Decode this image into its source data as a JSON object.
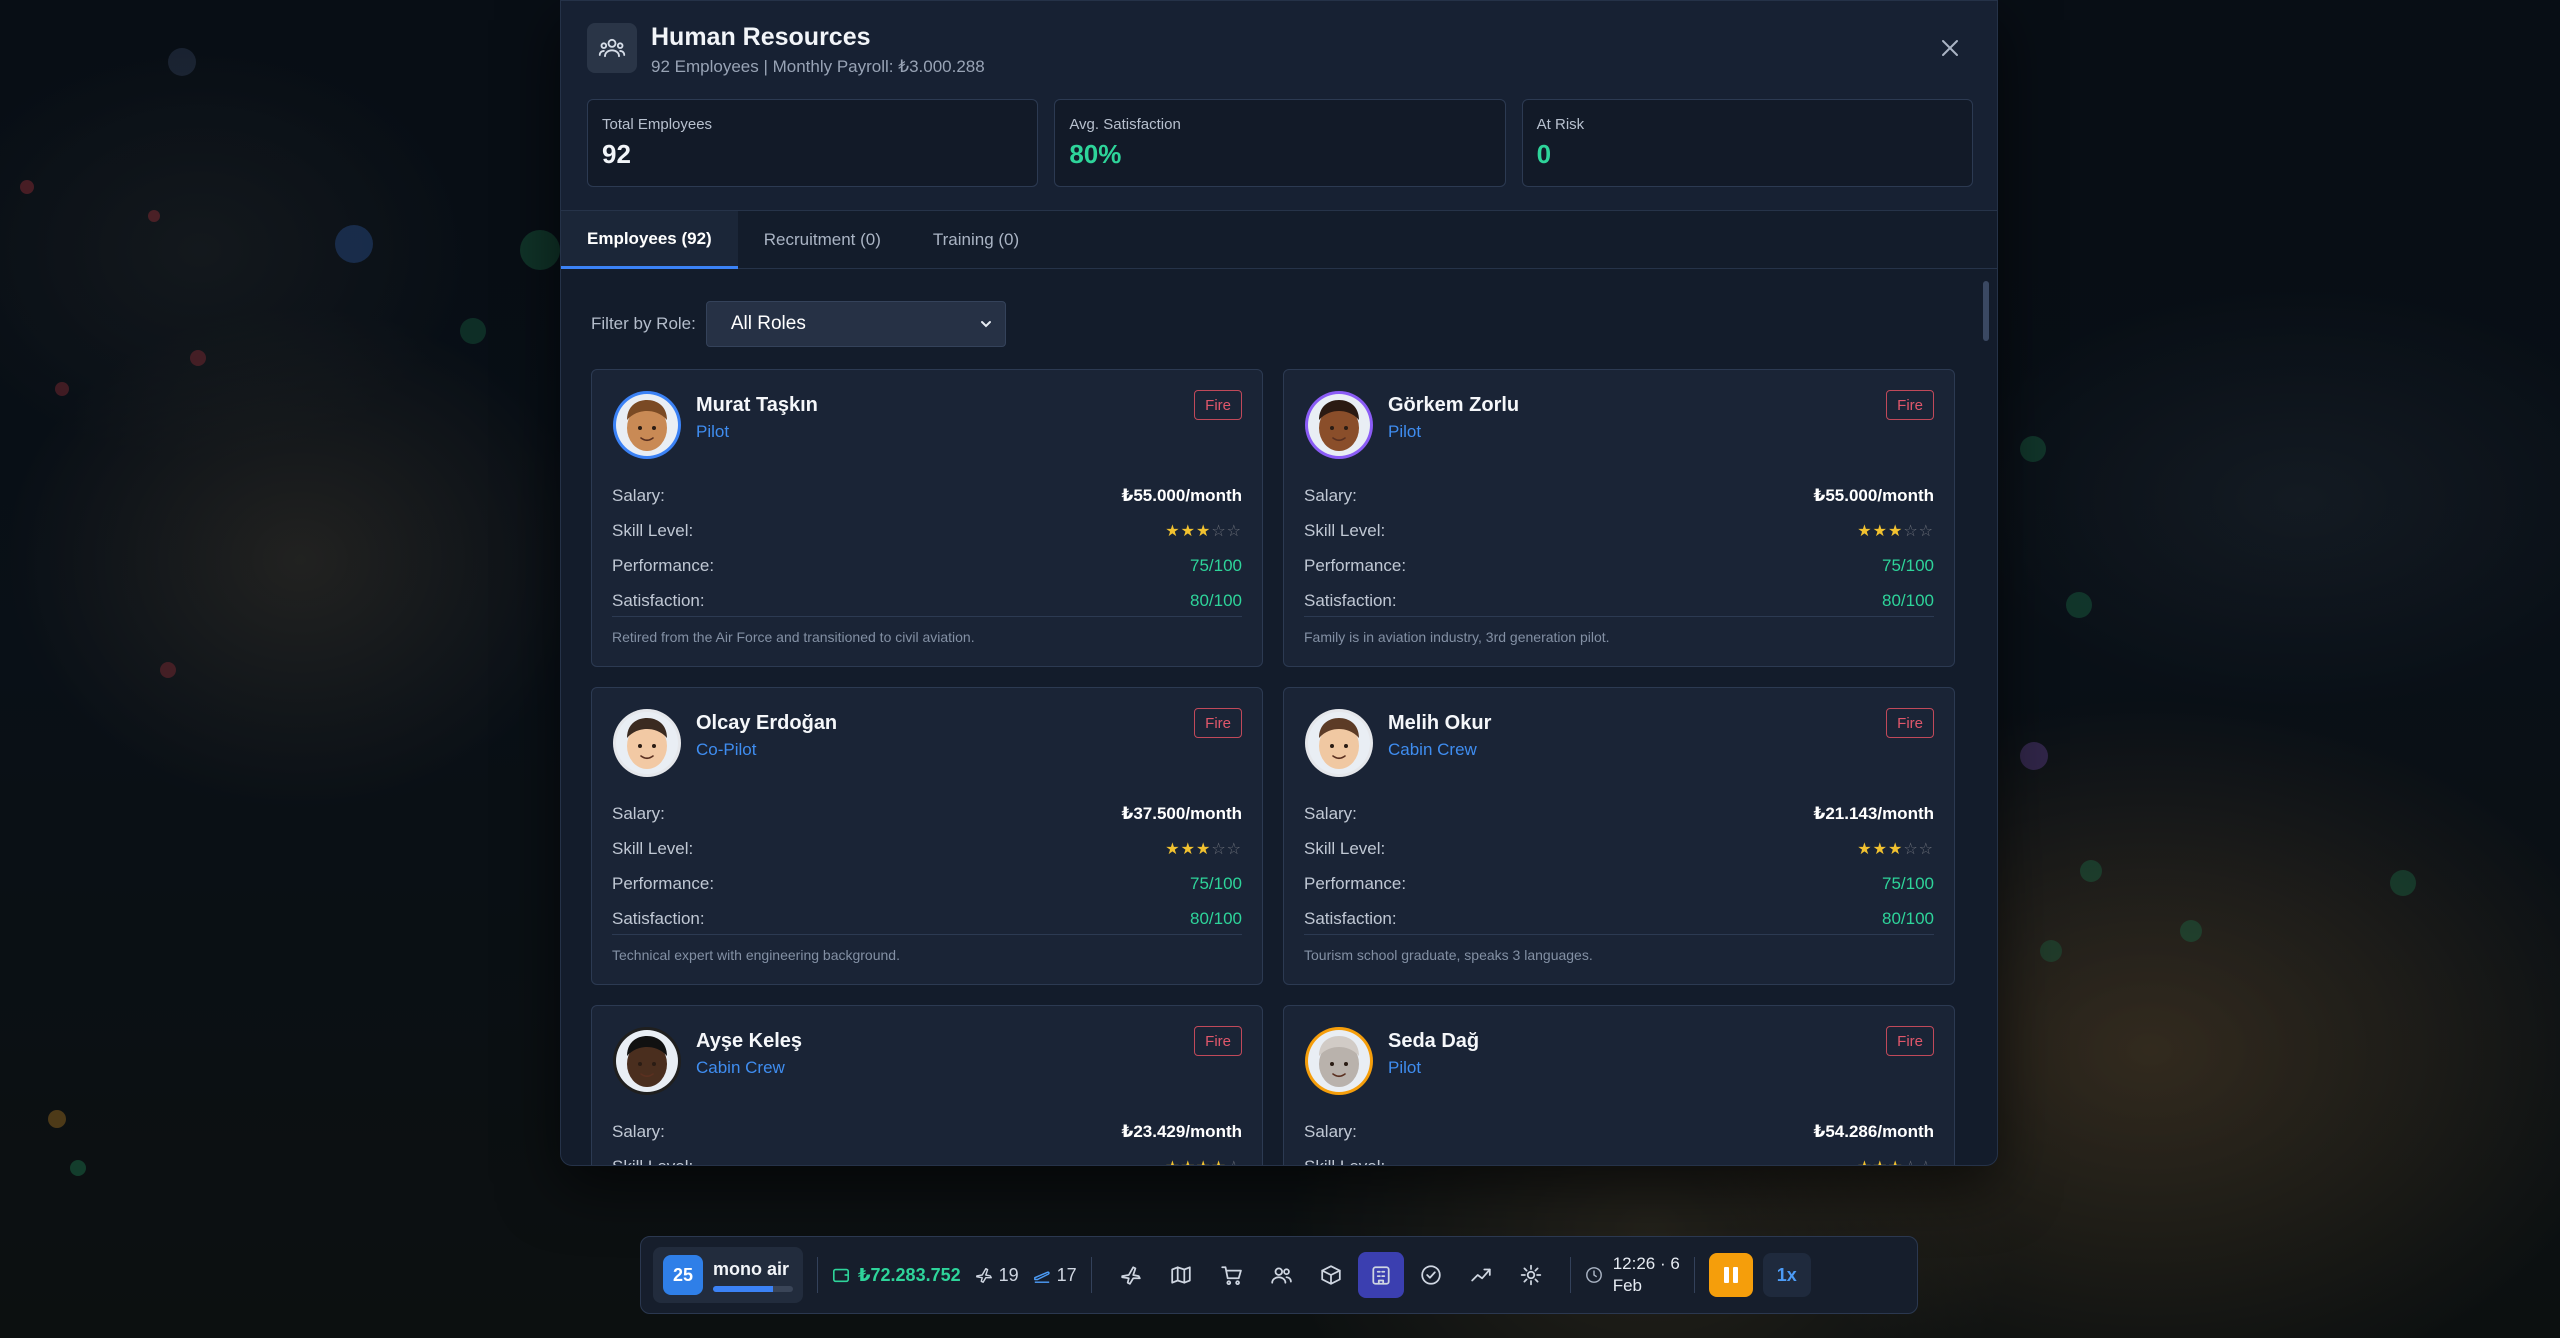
{
  "modal": {
    "title": "Human Resources",
    "subtitle": "92 Employees | Monthly Payroll: ₺3.000.288",
    "close_icon": "close-icon",
    "header_icon": "people-icon"
  },
  "stats": [
    {
      "label": "Total Employees",
      "value": "92"
    },
    {
      "label": "Avg. Satisfaction",
      "value": "80%"
    },
    {
      "label": "At Risk",
      "value": "0"
    }
  ],
  "tabs": [
    {
      "label": "Employees (92)",
      "active": true
    },
    {
      "label": "Recruitment (0)",
      "active": false
    },
    {
      "label": "Training (0)",
      "active": false
    }
  ],
  "filter": {
    "label": "Filter by Role:",
    "selected": "All Roles"
  },
  "field_labels": {
    "salary": "Salary:",
    "skill": "Skill Level:",
    "performance": "Performance:",
    "satisfaction": "Satisfaction:",
    "fire": "Fire"
  },
  "employees": [
    {
      "name": "Murat Taşkın",
      "role": "Pilot",
      "salary": "₺55.000/month",
      "skill_stars": 3,
      "performance": "75/100",
      "satisfaction": "80/100",
      "bio": "Retired from the Air Force and transitioned to civil aviation.",
      "avatar_ring": "#3b82f6",
      "skin": "#c98a55",
      "hair": "#7a4a24"
    },
    {
      "name": "Görkem Zorlu",
      "role": "Pilot",
      "salary": "₺55.000/month",
      "skill_stars": 3,
      "performance": "75/100",
      "satisfaction": "80/100",
      "bio": "Family is in aviation industry, 3rd generation pilot.",
      "avatar_ring": "#8b5cf6",
      "skin": "#8a4e2a",
      "hair": "#2b1a12"
    },
    {
      "name": "Olcay Erdoğan",
      "role": "Co-Pilot",
      "salary": "₺37.500/month",
      "skill_stars": 3,
      "performance": "75/100",
      "satisfaction": "80/100",
      "bio": "Technical expert with engineering background.",
      "avatar_ring": "#e5e7eb",
      "skin": "#f2c9a4",
      "hair": "#3a2a20"
    },
    {
      "name": "Melih Okur",
      "role": "Cabin Crew",
      "salary": "₺21.143/month",
      "skill_stars": 3,
      "performance": "75/100",
      "satisfaction": "80/100",
      "bio": "Tourism school graduate, speaks 3 languages.",
      "avatar_ring": "#e5e7eb",
      "skin": "#f0c8a2",
      "hair": "#5c3b26"
    },
    {
      "name": "Ayşe Keleş",
      "role": "Cabin Crew",
      "salary": "₺23.429/month",
      "skill_stars": 4,
      "performance": "",
      "satisfaction": "",
      "bio": "",
      "avatar_ring": "#1f1f1f",
      "skin": "#4a2e1e",
      "hair": "#111111"
    },
    {
      "name": "Seda Dağ",
      "role": "Pilot",
      "salary": "₺54.286/month",
      "skill_stars": 3,
      "performance": "",
      "satisfaction": "",
      "bio": "",
      "avatar_ring": "#f59e0b",
      "skin": "#b9b2ac",
      "hair": "#d1cbc6"
    }
  ],
  "bottom_bar": {
    "level": "25",
    "airline": "mono air",
    "xp_fraction": 0.75,
    "cash": "₺72.283.752",
    "planes": "19",
    "flights": "17",
    "nav_icons": [
      "plane-icon",
      "map-icon",
      "cart-icon",
      "people-icon",
      "box-icon",
      "building-icon",
      "check-circle-icon",
      "trend-icon",
      "gear-icon"
    ],
    "active_nav": "building-icon",
    "time": "12:26 · 6",
    "date": "Feb",
    "speed": "1x"
  }
}
